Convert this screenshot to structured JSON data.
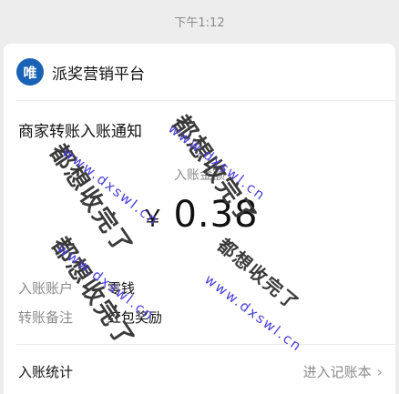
{
  "time": "下午1:12",
  "header": {
    "avatar_text": "唯",
    "avatar_color": "#1a62b6",
    "merchant_name": "派奖营销平台"
  },
  "notice": {
    "title": "商家转账入账通知",
    "amount_label": "入账金额",
    "currency": "￥",
    "amount": "0.38",
    "rows": [
      {
        "label": "入账账户",
        "value": "零钱"
      },
      {
        "label": "转账备注",
        "value": "红包奖励"
      }
    ]
  },
  "footer": {
    "left": "入账统计",
    "right": "进入记账本",
    "chevron_icon": "chevron-right-icon"
  },
  "watermark": {
    "cn": "都想收完了",
    "url": "www.dxswl.cn"
  }
}
